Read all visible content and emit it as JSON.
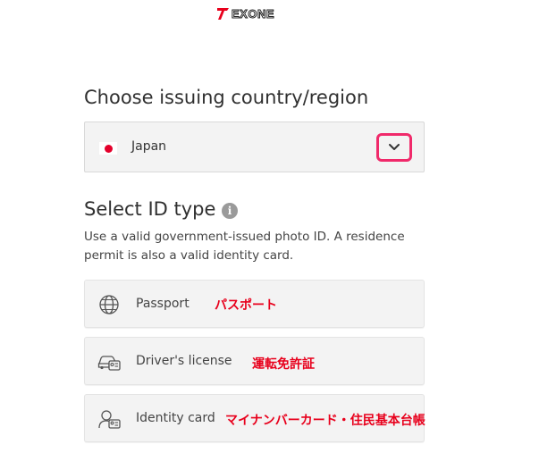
{
  "logo": {
    "text": "EXONE"
  },
  "country_section": {
    "title": "Choose issuing country/region",
    "selected_country": "Japan",
    "flag": "japan-flag"
  },
  "id_section": {
    "title": "Select ID type",
    "info_icon": "info-icon",
    "description": "Use a valid government-issued photo ID. A residence permit is also a valid identity card."
  },
  "id_options": [
    {
      "label": "Passport",
      "icon": "globe-icon",
      "annotation": "パスポート"
    },
    {
      "label": "Driver's license",
      "icon": "car-id-icon",
      "annotation": "運転免許証"
    },
    {
      "label": "Identity card",
      "icon": "person-id-icon",
      "annotation": "マイナンバーカード・住民基本台帳"
    }
  ],
  "colors": {
    "highlight": "#f0296a",
    "annotation": "#e8001c",
    "japan_red": "#e4002b",
    "panel_bg": "#f3f3f3"
  }
}
